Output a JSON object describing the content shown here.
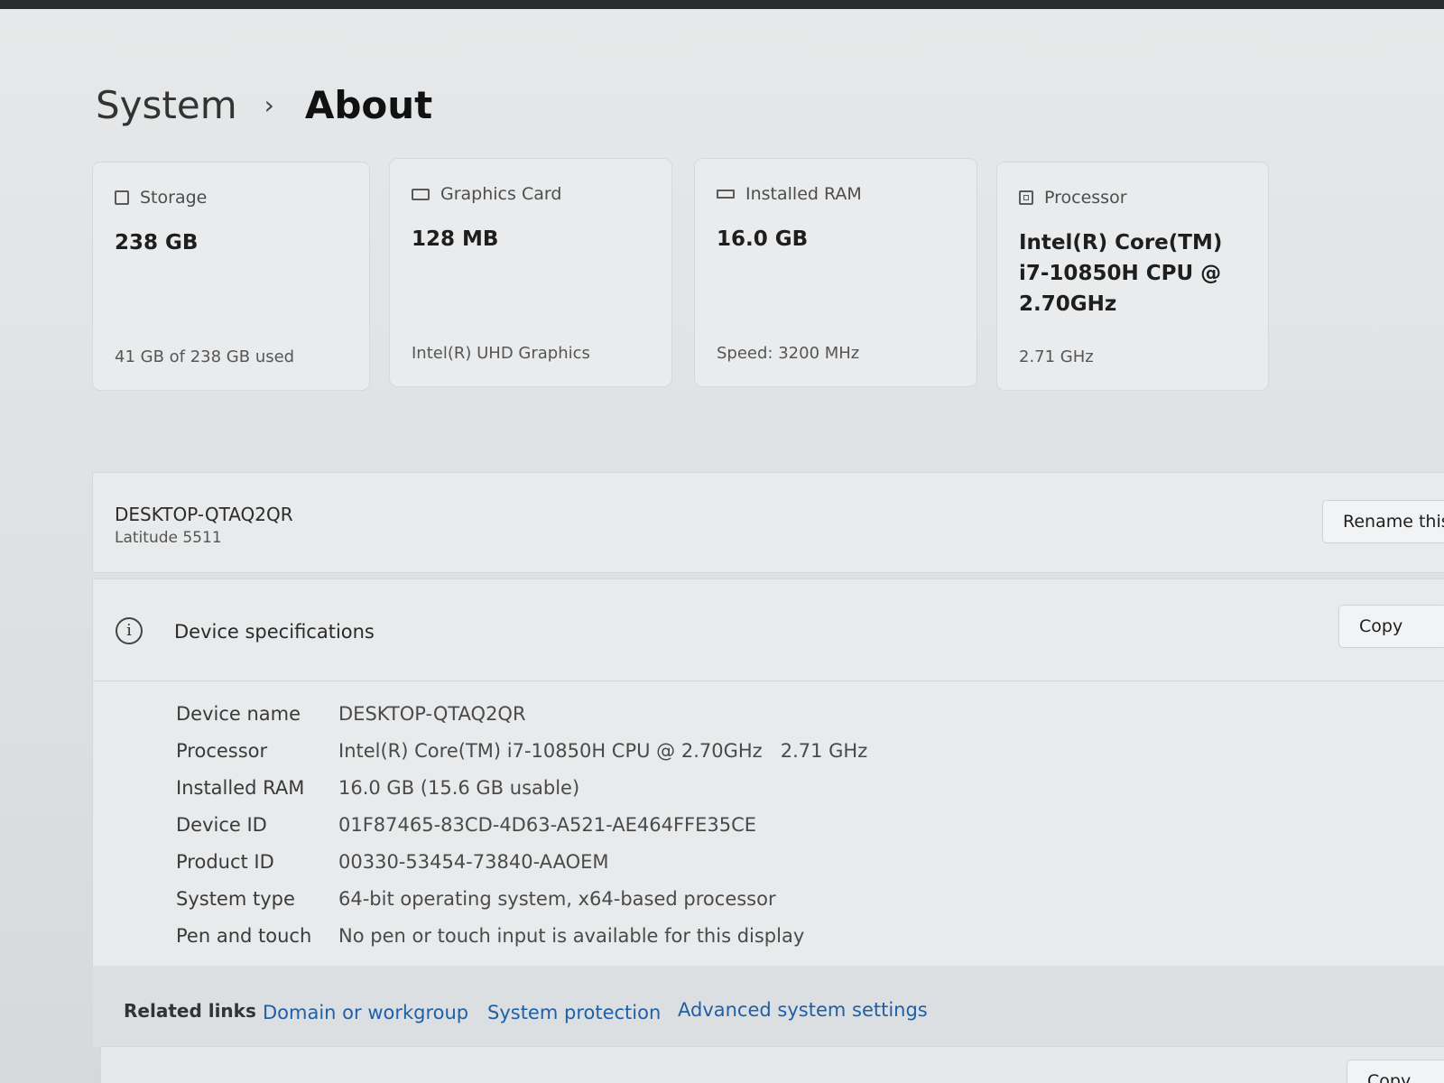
{
  "breadcrumb": {
    "parent": "System",
    "separator": "›",
    "current": "About"
  },
  "cards": {
    "storage": {
      "title": "Storage",
      "value": "238 GB",
      "sub": "41 GB of 238 GB used",
      "icon": "storage-icon"
    },
    "graphics": {
      "title": "Graphics Card",
      "value": "128 MB",
      "sub": "Intel(R) UHD Graphics",
      "icon": "graphics-card-icon"
    },
    "ram": {
      "title": "Installed RAM",
      "value": "16.0 GB",
      "sub": "Speed: 3200 MHz",
      "icon": "ram-icon"
    },
    "processor": {
      "title": "Processor",
      "value": "Intel(R) Core(TM) i7-10850H CPU @ 2.70GHz",
      "sub": "2.71 GHz",
      "icon": "processor-icon"
    }
  },
  "device": {
    "name": "DESKTOP-QTAQ2QR",
    "model": "Latitude 5511",
    "rename_label": "Rename this"
  },
  "specs": {
    "title": "Device specifications",
    "copy_label": "Copy",
    "rows": [
      {
        "key": "Device name",
        "value": "DESKTOP-QTAQ2QR"
      },
      {
        "key": "Processor",
        "value": "Intel(R) Core(TM) i7-10850H CPU @ 2.70GHz   2.71 GHz"
      },
      {
        "key": "Installed RAM",
        "value": "16.0 GB (15.6 GB usable)"
      },
      {
        "key": "Device ID",
        "value": "01F87465-83CD-4D63-A521-AE464FFE35CE"
      },
      {
        "key": "Product ID",
        "value": "00330-53454-73840-AAOEM"
      },
      {
        "key": "System type",
        "value": "64-bit operating system, x64-based processor"
      },
      {
        "key": "Pen and touch",
        "value": "No pen or touch input is available for this display"
      }
    ]
  },
  "related": {
    "label": "Related links",
    "links": [
      "Domain or workgroup",
      "System protection",
      "Advanced system settings"
    ]
  },
  "bottom": {
    "copy_label": "Copy"
  }
}
